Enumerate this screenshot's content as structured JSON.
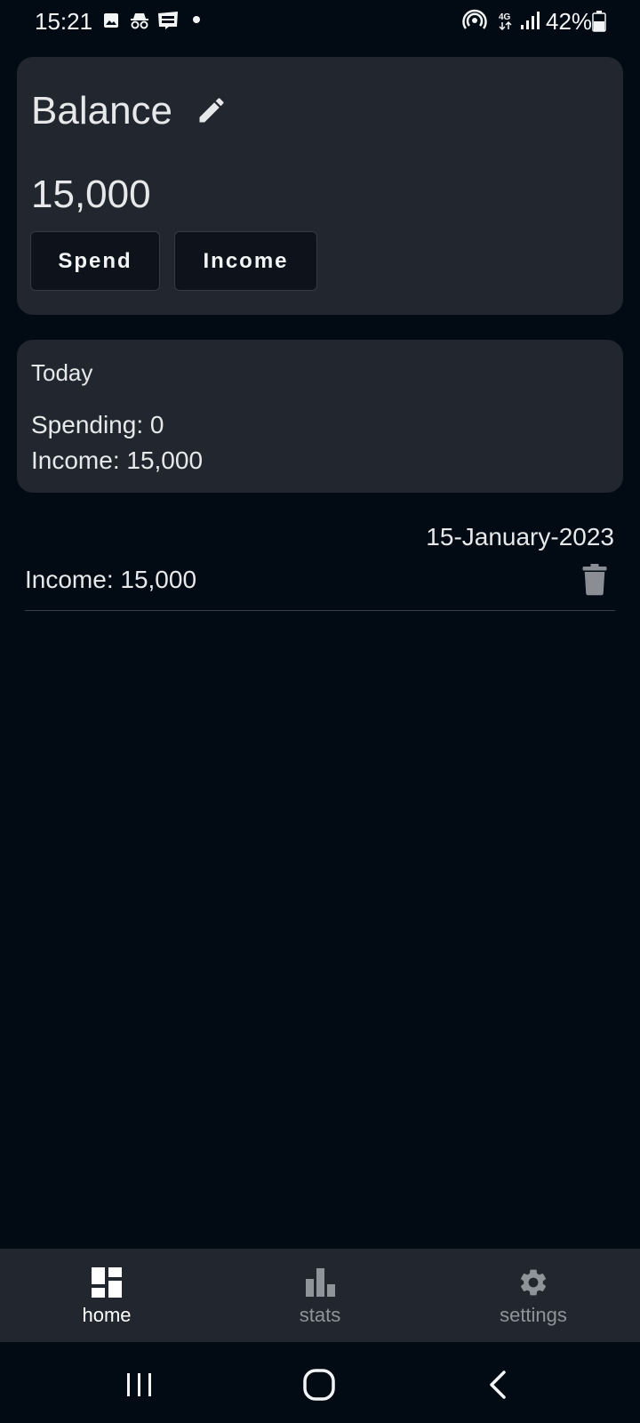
{
  "status_bar": {
    "time": "15:21",
    "battery": "42%",
    "notification_icons": [
      "image-icon",
      "incognito-icon",
      "webtoon-icon",
      "dot-icon"
    ],
    "system_icons": [
      "hotspot-icon",
      "4g-icon",
      "signal-icon",
      "battery-icon"
    ]
  },
  "balance_card": {
    "title": "Balance",
    "amount": "15,000",
    "spend_label": "Spend",
    "income_label": "Income"
  },
  "today_card": {
    "title": "Today",
    "spending": "Spending: 0",
    "income": "Income: 15,000"
  },
  "transactions": [
    {
      "date": "15-January-2023",
      "entries": [
        {
          "text": "Income: 15,000"
        }
      ]
    }
  ],
  "bottom_nav": {
    "items": [
      {
        "label": "home",
        "icon": "dashboard-icon",
        "active": true
      },
      {
        "label": "stats",
        "icon": "bar-chart-icon",
        "active": false
      },
      {
        "label": "settings",
        "icon": "gear-icon",
        "active": false
      }
    ]
  },
  "colors": {
    "background": "#020a13",
    "card": "#22272f",
    "button": "#0d121b",
    "text": "#e6e8ea",
    "muted": "#8f949b"
  }
}
